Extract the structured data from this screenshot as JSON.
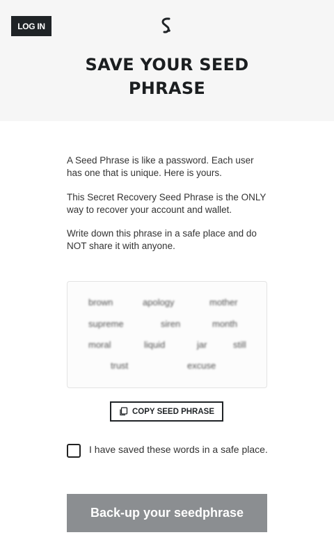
{
  "header": {
    "login_label": "LOG IN",
    "logo_icon": "s-logo-icon",
    "title_line1": "SAVE YOUR SEED",
    "title_line2": "PHRASE"
  },
  "intro": {
    "para1": "A Seed Phrase is like a password. Each user has one that is unique. Here is yours.",
    "para2": "This Secret Recovery Seed Phrase is the ONLY way to recover your account and wallet.",
    "para3": "Write down this phrase in a safe place and do NOT share it with anyone."
  },
  "seed": {
    "words": [
      "brown",
      "apology",
      "mother",
      "supreme",
      "siren",
      "month",
      "moral",
      "liquid",
      "jar",
      "still",
      "trust",
      "excuse"
    ],
    "copy_label": "COPY SEED PHRASE",
    "copy_icon": "copy-icon"
  },
  "confirm": {
    "checked": false,
    "label": "I have saved these words in a safe place."
  },
  "actions": {
    "backup_label": "Back-up your seedphrase",
    "backup_color": "#8b8e91"
  }
}
